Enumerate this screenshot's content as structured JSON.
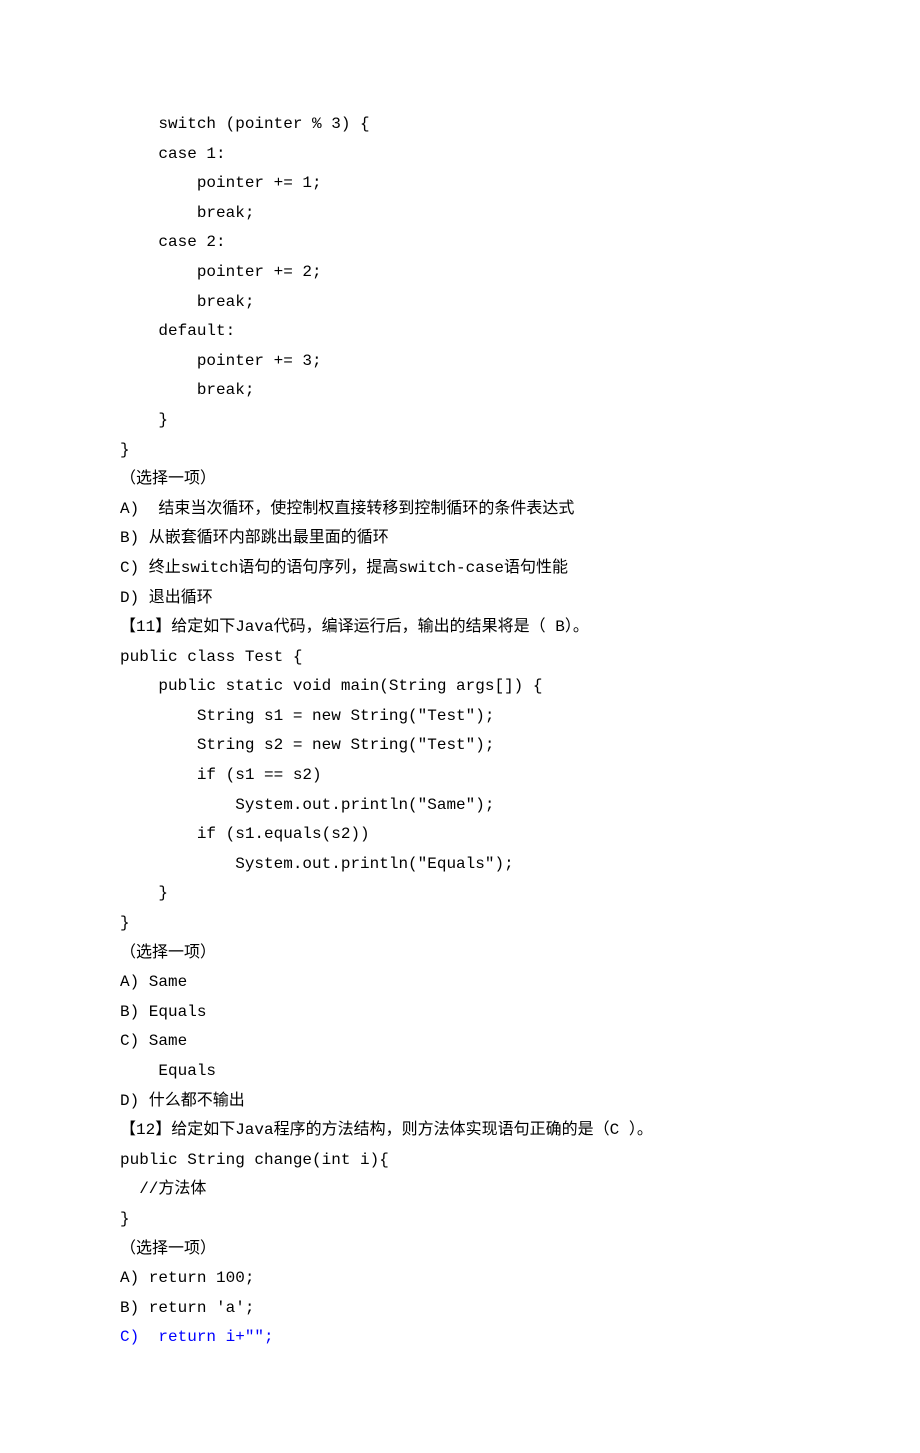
{
  "lines": [
    {
      "t": "    switch (pointer % 3) {"
    },
    {
      "t": "    case 1:"
    },
    {
      "t": "        pointer += 1;"
    },
    {
      "t": "        break;"
    },
    {
      "t": "    case 2:"
    },
    {
      "t": "        pointer += 2;"
    },
    {
      "t": "        break;"
    },
    {
      "t": "    default:"
    },
    {
      "t": "        pointer += 3;"
    },
    {
      "t": "        break;"
    },
    {
      "t": "    }"
    },
    {
      "t": "}"
    },
    {
      "t": ""
    },
    {
      "t": "（选择一项）"
    },
    {
      "t": "A)  结束当次循环，使控制权直接转移到控制循环的条件表达式"
    },
    {
      "t": "B) 从嵌套循环内部跳出最里面的循环"
    },
    {
      "t": "C) 终止switch语句的语句序列，提高switch-case语句性能"
    },
    {
      "t": "D) 退出循环"
    },
    {
      "t": "【11】给定如下Java代码，编译运行后，输出的结果将是（ B）。"
    },
    {
      "t": "public class Test {"
    },
    {
      "t": "    public static void main(String args[]) {"
    },
    {
      "t": "        String s1 = new String(\"Test\");"
    },
    {
      "t": "        String s2 = new String(\"Test\");"
    },
    {
      "t": "        if (s1 == s2)"
    },
    {
      "t": "            System.out.println(\"Same\");"
    },
    {
      "t": "        if (s1.equals(s2))"
    },
    {
      "t": "            System.out.println(\"Equals\");"
    },
    {
      "t": "    }"
    },
    {
      "t": "}"
    },
    {
      "t": ""
    },
    {
      "t": "（选择一项）"
    },
    {
      "t": "A) Same"
    },
    {
      "t": "B) Equals"
    },
    {
      "t": "C) Same"
    },
    {
      "t": "    Equals"
    },
    {
      "t": "D) 什么都不输出"
    },
    {
      "t": "【12】给定如下Java程序的方法结构，则方法体实现语句正确的是（C ）。"
    },
    {
      "t": "public String change(int i){"
    },
    {
      "t": "  //方法体"
    },
    {
      "t": "}"
    },
    {
      "t": "（选择一项）"
    },
    {
      "t": "A) return 100;"
    },
    {
      "t": "B) return 'a';"
    },
    {
      "t": "C)  return i+\"\";",
      "c": "blue"
    }
  ]
}
